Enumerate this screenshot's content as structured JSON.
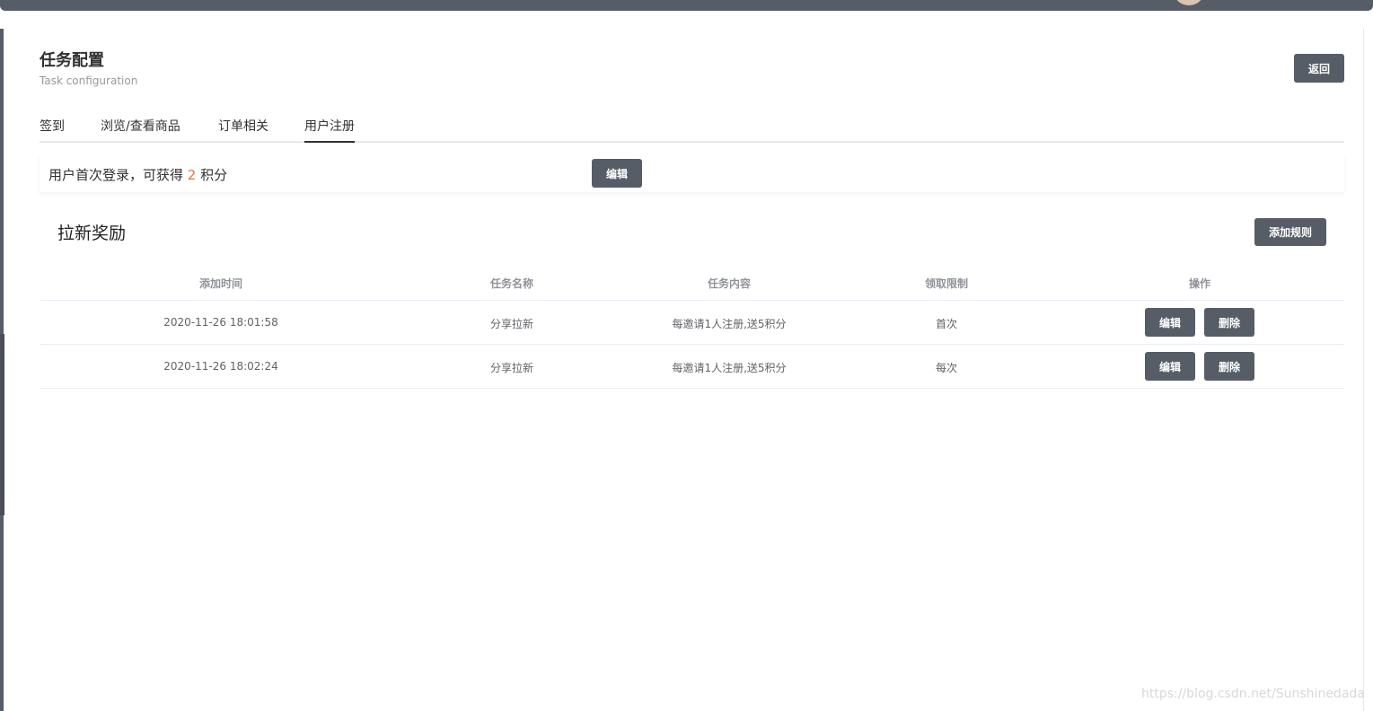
{
  "header": {
    "title": "任务配置",
    "subtitle": "Task configuration",
    "back_label": "返回"
  },
  "tabs": [
    {
      "label": "签到"
    },
    {
      "label": "浏览/查看商品"
    },
    {
      "label": "订单相关"
    },
    {
      "label": "用户注册"
    }
  ],
  "login_reward": {
    "prefix": "用户首次登录，可获得 ",
    "points": "2",
    "suffix": " 积分",
    "edit_label": "编辑"
  },
  "section": {
    "title": "拉新奖励",
    "add_rule_label": "添加规则"
  },
  "table": {
    "headers": [
      "添加时间",
      "任务名称",
      "任务内容",
      "领取限制",
      "操作"
    ],
    "rows": [
      {
        "time": "2020-11-26 18:01:58",
        "name": "分享拉新",
        "content": "每邀请1人注册,送5积分",
        "limit": "首次",
        "edit": "编辑",
        "delete": "删除"
      },
      {
        "time": "2020-11-26 18:02:24",
        "name": "分享拉新",
        "content": "每邀请1人注册,送5积分",
        "limit": "每次",
        "edit": "编辑",
        "delete": "删除"
      }
    ]
  },
  "watermark": "https://blog.csdn.net/Sunshinedada"
}
